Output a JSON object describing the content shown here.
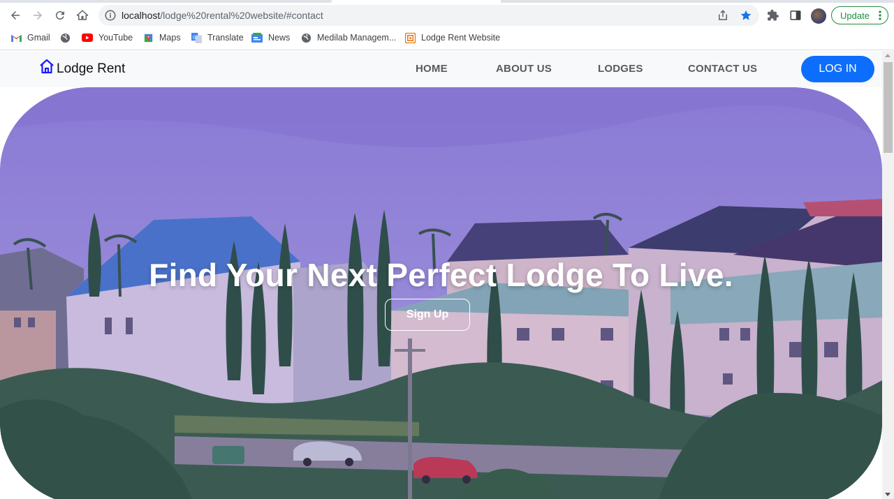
{
  "browser": {
    "url_host": "localhost",
    "url_path": "/lodge%20rental%20website/#contact",
    "update_label": "Update",
    "bookmarks": [
      {
        "label": "Gmail",
        "icon": "gmail-icon"
      },
      {
        "label": "",
        "icon": "globe-icon"
      },
      {
        "label": "YouTube",
        "icon": "youtube-icon"
      },
      {
        "label": "Maps",
        "icon": "maps-icon"
      },
      {
        "label": "Translate",
        "icon": "translate-icon"
      },
      {
        "label": "News",
        "icon": "news-icon"
      },
      {
        "label": "Medilab Managem...",
        "icon": "globe-icon"
      },
      {
        "label": "Lodge Rent Website",
        "icon": "site-icon"
      }
    ],
    "accent_color": "#1a73e8",
    "update_color": "#1e8e3e"
  },
  "site": {
    "brand": "Lodge Rent",
    "nav": {
      "home": "HOME",
      "about": "ABOUT US",
      "lodges": "LODGES",
      "contact": "CONTACT US",
      "login": "LOG IN"
    },
    "hero": {
      "title": "Find Your Next Perfect Lodge To Live.",
      "signup": "Sign Up"
    },
    "brand_color": "#0d6efd"
  }
}
